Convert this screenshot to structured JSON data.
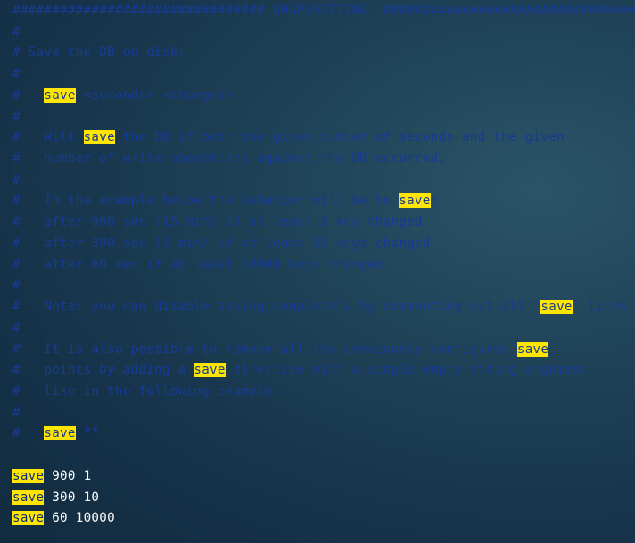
{
  "editor": {
    "theme": {
      "comment_color": "#173b94",
      "highlight_background": "#ffe600",
      "plain_text_color": "#ffffff",
      "background_color": "#1c3d52"
    },
    "lines": [
      {
        "kind": "comment",
        "segments": [
          {
            "text": "################################ SNAPSHOTTING  ################################",
            "hl": false
          }
        ]
      },
      {
        "kind": "comment",
        "segments": [
          {
            "text": "#",
            "hl": false
          }
        ]
      },
      {
        "kind": "comment",
        "segments": [
          {
            "text": "# Save the DB on disk:",
            "hl": false
          }
        ]
      },
      {
        "kind": "comment",
        "segments": [
          {
            "text": "#",
            "hl": false
          }
        ]
      },
      {
        "kind": "comment",
        "segments": [
          {
            "text": "#   ",
            "hl": false
          },
          {
            "text": "save",
            "hl": true
          },
          {
            "text": " <seconds> <changes>",
            "hl": false
          }
        ]
      },
      {
        "kind": "comment",
        "segments": [
          {
            "text": "#",
            "hl": false
          }
        ]
      },
      {
        "kind": "comment",
        "segments": [
          {
            "text": "#   Will ",
            "hl": false
          },
          {
            "text": "save",
            "hl": true
          },
          {
            "text": " the DB if both the given number of seconds and the given",
            "hl": false
          }
        ]
      },
      {
        "kind": "comment",
        "segments": [
          {
            "text": "#   number of write operations against the DB occurred.",
            "hl": false
          }
        ]
      },
      {
        "kind": "comment",
        "segments": [
          {
            "text": "#",
            "hl": false
          }
        ]
      },
      {
        "kind": "comment",
        "segments": [
          {
            "text": "#   In the example below the behavior will be to ",
            "hl": false
          },
          {
            "text": "save",
            "hl": true
          },
          {
            "text": ":",
            "hl": false
          }
        ]
      },
      {
        "kind": "comment",
        "segments": [
          {
            "text": "#   after 900 sec (15 min) if at least 1 key changed",
            "hl": false
          }
        ]
      },
      {
        "kind": "comment",
        "segments": [
          {
            "text": "#   after 300 sec (5 min) if at least 10 keys changed",
            "hl": false
          }
        ]
      },
      {
        "kind": "comment",
        "segments": [
          {
            "text": "#   after 60 sec if at least 10000 keys changed",
            "hl": false
          }
        ]
      },
      {
        "kind": "comment",
        "segments": [
          {
            "text": "#",
            "hl": false
          }
        ]
      },
      {
        "kind": "comment",
        "segments": [
          {
            "text": "#   Note: you can disable saving completely by commenting out all \"",
            "hl": false
          },
          {
            "text": "save",
            "hl": true
          },
          {
            "text": "\" lines.",
            "hl": false
          }
        ]
      },
      {
        "kind": "comment",
        "segments": [
          {
            "text": "#",
            "hl": false
          }
        ]
      },
      {
        "kind": "comment",
        "segments": [
          {
            "text": "#   It is also possible to remove all the previously configured ",
            "hl": false
          },
          {
            "text": "save",
            "hl": true
          }
        ]
      },
      {
        "kind": "comment",
        "segments": [
          {
            "text": "#   points by adding a ",
            "hl": false
          },
          {
            "text": "save",
            "hl": true
          },
          {
            "text": " directive with a single empty string argument",
            "hl": false
          }
        ]
      },
      {
        "kind": "comment",
        "segments": [
          {
            "text": "#   like in the following example:",
            "hl": false
          }
        ]
      },
      {
        "kind": "comment",
        "segments": [
          {
            "text": "#",
            "hl": false
          }
        ]
      },
      {
        "kind": "comment",
        "segments": [
          {
            "text": "#   ",
            "hl": false
          },
          {
            "text": "save",
            "hl": true
          },
          {
            "text": " \"\"",
            "hl": false
          }
        ]
      },
      {
        "kind": "blank",
        "segments": [
          {
            "text": "",
            "hl": false
          }
        ]
      },
      {
        "kind": "directive",
        "segments": [
          {
            "text": "save",
            "hl": true
          },
          {
            "text": " 900 1",
            "hl": false
          }
        ]
      },
      {
        "kind": "directive",
        "segments": [
          {
            "text": "save",
            "hl": true
          },
          {
            "text": " 300 10",
            "hl": false
          }
        ]
      },
      {
        "kind": "directive",
        "segments": [
          {
            "text": "save",
            "hl": true
          },
          {
            "text": " 60 10000",
            "hl": false
          }
        ]
      }
    ]
  }
}
